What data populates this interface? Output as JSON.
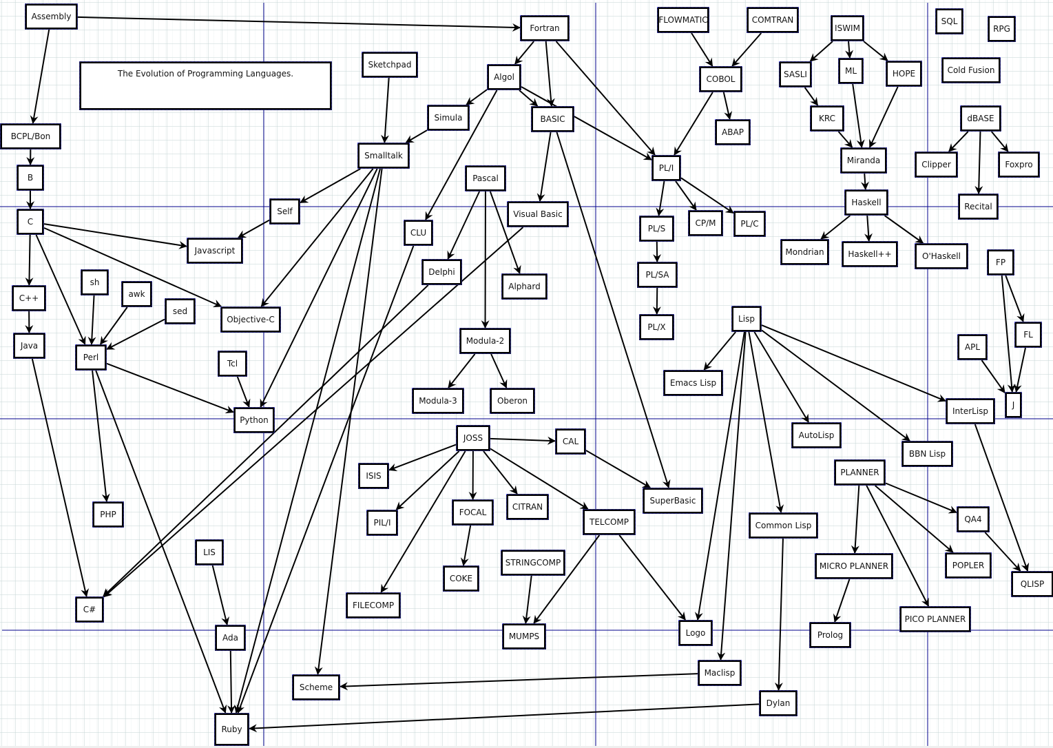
{
  "title": "The Evolution of Programming Languages.",
  "colors": {
    "page_divider": "#00008b",
    "edge": "#000000",
    "node_border": "#000000",
    "handle": "#4a4ad8",
    "grid": "#c8d7d7"
  },
  "nodes": [
    {
      "id": "assembly",
      "label": "Assembly"
    },
    {
      "id": "fortran",
      "label": "Fortran"
    },
    {
      "id": "flowmatic",
      "label": "FLOWMATIC"
    },
    {
      "id": "comtran",
      "label": "COMTRAN"
    },
    {
      "id": "iswim",
      "label": "ISWIM"
    },
    {
      "id": "sql",
      "label": "SQL"
    },
    {
      "id": "rpg",
      "label": "RPG"
    },
    {
      "id": "sketchpad",
      "label": "Sketchpad"
    },
    {
      "id": "algol",
      "label": "Algol"
    },
    {
      "id": "cobol",
      "label": "COBOL"
    },
    {
      "id": "sasli",
      "label": "SASLI"
    },
    {
      "id": "ml",
      "label": "ML"
    },
    {
      "id": "hope",
      "label": "HOPE"
    },
    {
      "id": "coldfusion",
      "label": "Cold Fusion"
    },
    {
      "id": "simula",
      "label": "Simula"
    },
    {
      "id": "basic",
      "label": "BASIC"
    },
    {
      "id": "krc",
      "label": "KRC"
    },
    {
      "id": "dbase",
      "label": "dBASE"
    },
    {
      "id": "abap",
      "label": "ABAP"
    },
    {
      "id": "bcpl",
      "label": "BCPL/Bon"
    },
    {
      "id": "smalltalk",
      "label": "Smalltalk"
    },
    {
      "id": "pli",
      "label": "PL/I"
    },
    {
      "id": "miranda",
      "label": "Miranda"
    },
    {
      "id": "clipper",
      "label": "Clipper"
    },
    {
      "id": "foxpro",
      "label": "Foxpro"
    },
    {
      "id": "b",
      "label": "B"
    },
    {
      "id": "pascal",
      "label": "Pascal"
    },
    {
      "id": "haskell",
      "label": "Haskell"
    },
    {
      "id": "recital",
      "label": "Recital"
    },
    {
      "id": "self",
      "label": "Self"
    },
    {
      "id": "visualbasic",
      "label": "Visual Basic"
    },
    {
      "id": "c",
      "label": "C"
    },
    {
      "id": "pls",
      "label": "PL/S"
    },
    {
      "id": "cpm",
      "label": "CP/M"
    },
    {
      "id": "plc",
      "label": "PL/C"
    },
    {
      "id": "clu",
      "label": "CLU"
    },
    {
      "id": "javascript",
      "label": "Javascript"
    },
    {
      "id": "mondrian",
      "label": "Mondrian"
    },
    {
      "id": "haskellpp",
      "label": "Haskell++"
    },
    {
      "id": "ohaskell",
      "label": "O'Haskell"
    },
    {
      "id": "fp",
      "label": "FP"
    },
    {
      "id": "delphi",
      "label": "Delphi"
    },
    {
      "id": "sh",
      "label": "sh"
    },
    {
      "id": "plsa",
      "label": "PL/SA"
    },
    {
      "id": "alphard",
      "label": "Alphard"
    },
    {
      "id": "awk",
      "label": "awk"
    },
    {
      "id": "cpp",
      "label": "C++"
    },
    {
      "id": "sed",
      "label": "sed"
    },
    {
      "id": "objc",
      "label": "Objective-C"
    },
    {
      "id": "lisp",
      "label": "Lisp"
    },
    {
      "id": "plx",
      "label": "PL/X"
    },
    {
      "id": "fl",
      "label": "FL"
    },
    {
      "id": "modula2",
      "label": "Modula-2"
    },
    {
      "id": "java",
      "label": "Java"
    },
    {
      "id": "perl",
      "label": "Perl"
    },
    {
      "id": "apl",
      "label": "APL"
    },
    {
      "id": "tcl",
      "label": "Tcl"
    },
    {
      "id": "emacslisp",
      "label": "Emacs Lisp"
    },
    {
      "id": "modula3",
      "label": "Modula-3"
    },
    {
      "id": "oberon",
      "label": "Oberon"
    },
    {
      "id": "j",
      "label": "J"
    },
    {
      "id": "interlisp",
      "label": "InterLisp"
    },
    {
      "id": "python",
      "label": "Python"
    },
    {
      "id": "joss",
      "label": "JOSS"
    },
    {
      "id": "cal",
      "label": "CAL"
    },
    {
      "id": "autolisp",
      "label": "AutoLisp"
    },
    {
      "id": "bbnlisp",
      "label": "BBN Lisp"
    },
    {
      "id": "isis",
      "label": "ISIS"
    },
    {
      "id": "planner",
      "label": "PLANNER"
    },
    {
      "id": "superbasic",
      "label": "SuperBasic"
    },
    {
      "id": "php",
      "label": "PHP"
    },
    {
      "id": "pili",
      "label": "PIL/I"
    },
    {
      "id": "focal",
      "label": "FOCAL"
    },
    {
      "id": "citran",
      "label": "CITRAN"
    },
    {
      "id": "telcomp",
      "label": "TELCOMP"
    },
    {
      "id": "qa4",
      "label": "QA4"
    },
    {
      "id": "commonlisp",
      "label": "Common Lisp"
    },
    {
      "id": "lis",
      "label": "LIS"
    },
    {
      "id": "stringcomp",
      "label": "STRINGCOMP"
    },
    {
      "id": "microplanner",
      "label": "MICRO PLANNER"
    },
    {
      "id": "popler",
      "label": "POPLER"
    },
    {
      "id": "coke",
      "label": "COKE"
    },
    {
      "id": "qlisp",
      "label": "QLISP"
    },
    {
      "id": "csharp",
      "label": "C#"
    },
    {
      "id": "filecomp",
      "label": "FILECOMP"
    },
    {
      "id": "picoplanner",
      "label": "PICO PLANNER"
    },
    {
      "id": "ada",
      "label": "Ada"
    },
    {
      "id": "mumps",
      "label": "MUMPS"
    },
    {
      "id": "logo",
      "label": "Logo"
    },
    {
      "id": "prolog",
      "label": "Prolog"
    },
    {
      "id": "maclisp",
      "label": "Maclisp"
    },
    {
      "id": "scheme",
      "label": "Scheme"
    },
    {
      "id": "dylan",
      "label": "Dylan"
    },
    {
      "id": "ruby",
      "label": "Ruby"
    }
  ],
  "edges": [
    [
      "assembly",
      "fortran"
    ],
    [
      "assembly",
      "bcpl"
    ],
    [
      "bcpl",
      "b"
    ],
    [
      "b",
      "c"
    ],
    [
      "c",
      "cpp"
    ],
    [
      "c",
      "javascript"
    ],
    [
      "c",
      "objc"
    ],
    [
      "c",
      "perl"
    ],
    [
      "cpp",
      "java"
    ],
    [
      "java",
      "csharp"
    ],
    [
      "sh",
      "perl"
    ],
    [
      "awk",
      "perl"
    ],
    [
      "sed",
      "perl"
    ],
    [
      "perl",
      "python"
    ],
    [
      "perl",
      "php"
    ],
    [
      "perl",
      "ruby"
    ],
    [
      "tcl",
      "python"
    ],
    [
      "self",
      "javascript"
    ],
    [
      "sketchpad",
      "smalltalk"
    ],
    [
      "simula",
      "smalltalk"
    ],
    [
      "smalltalk",
      "self"
    ],
    [
      "smalltalk",
      "objc"
    ],
    [
      "smalltalk",
      "python"
    ],
    [
      "smalltalk",
      "ruby"
    ],
    [
      "smalltalk",
      "scheme"
    ],
    [
      "fortran",
      "algol"
    ],
    [
      "fortran",
      "basic"
    ],
    [
      "fortran",
      "pli"
    ],
    [
      "algol",
      "simula"
    ],
    [
      "algol",
      "basic"
    ],
    [
      "algol",
      "clu"
    ],
    [
      "algol",
      "pli"
    ],
    [
      "basic",
      "visualbasic"
    ],
    [
      "basic",
      "superbasic"
    ],
    [
      "visualbasic",
      "csharp"
    ],
    [
      "delphi",
      "csharp"
    ],
    [
      "clu",
      "ruby"
    ],
    [
      "pascal",
      "delphi"
    ],
    [
      "pascal",
      "modula2"
    ],
    [
      "pascal",
      "alphard"
    ],
    [
      "modula2",
      "modula3"
    ],
    [
      "modula2",
      "oberon"
    ],
    [
      "flowmatic",
      "cobol"
    ],
    [
      "comtran",
      "cobol"
    ],
    [
      "cobol",
      "abap"
    ],
    [
      "cobol",
      "pli"
    ],
    [
      "pli",
      "pls"
    ],
    [
      "pli",
      "cpm"
    ],
    [
      "pli",
      "plc"
    ],
    [
      "pls",
      "plsa"
    ],
    [
      "plsa",
      "plx"
    ],
    [
      "iswim",
      "sasli"
    ],
    [
      "iswim",
      "ml"
    ],
    [
      "iswim",
      "hope"
    ],
    [
      "sasli",
      "krc"
    ],
    [
      "krc",
      "miranda"
    ],
    [
      "ml",
      "miranda"
    ],
    [
      "hope",
      "miranda"
    ],
    [
      "miranda",
      "haskell"
    ],
    [
      "haskell",
      "mondrian"
    ],
    [
      "haskell",
      "haskellpp"
    ],
    [
      "haskell",
      "ohaskell"
    ],
    [
      "dbase",
      "clipper"
    ],
    [
      "dbase",
      "recital"
    ],
    [
      "dbase",
      "foxpro"
    ],
    [
      "fp",
      "fl"
    ],
    [
      "fp",
      "j"
    ],
    [
      "fl",
      "j"
    ],
    [
      "apl",
      "j"
    ],
    [
      "lisp",
      "emacslisp"
    ],
    [
      "lisp",
      "autolisp"
    ],
    [
      "lisp",
      "bbnlisp"
    ],
    [
      "lisp",
      "interlisp"
    ],
    [
      "lisp",
      "commonlisp"
    ],
    [
      "lisp",
      "logo"
    ],
    [
      "lisp",
      "maclisp"
    ],
    [
      "interlisp",
      "qlisp"
    ],
    [
      "commonlisp",
      "dylan"
    ],
    [
      "dylan",
      "ruby"
    ],
    [
      "maclisp",
      "scheme"
    ],
    [
      "joss",
      "cal"
    ],
    [
      "joss",
      "isis"
    ],
    [
      "joss",
      "pili"
    ],
    [
      "joss",
      "focal"
    ],
    [
      "joss",
      "citran"
    ],
    [
      "joss",
      "telcomp"
    ],
    [
      "joss",
      "filecomp"
    ],
    [
      "cal",
      "superbasic"
    ],
    [
      "focal",
      "coke"
    ],
    [
      "telcomp",
      "mumps"
    ],
    [
      "telcomp",
      "logo"
    ],
    [
      "stringcomp",
      "mumps"
    ],
    [
      "planner",
      "microplanner"
    ],
    [
      "planner",
      "qa4"
    ],
    [
      "planner",
      "popler"
    ],
    [
      "planner",
      "picoplanner"
    ],
    [
      "qa4",
      "qlisp"
    ],
    [
      "microplanner",
      "prolog"
    ],
    [
      "lis",
      "ada"
    ],
    [
      "ada",
      "ruby"
    ]
  ]
}
